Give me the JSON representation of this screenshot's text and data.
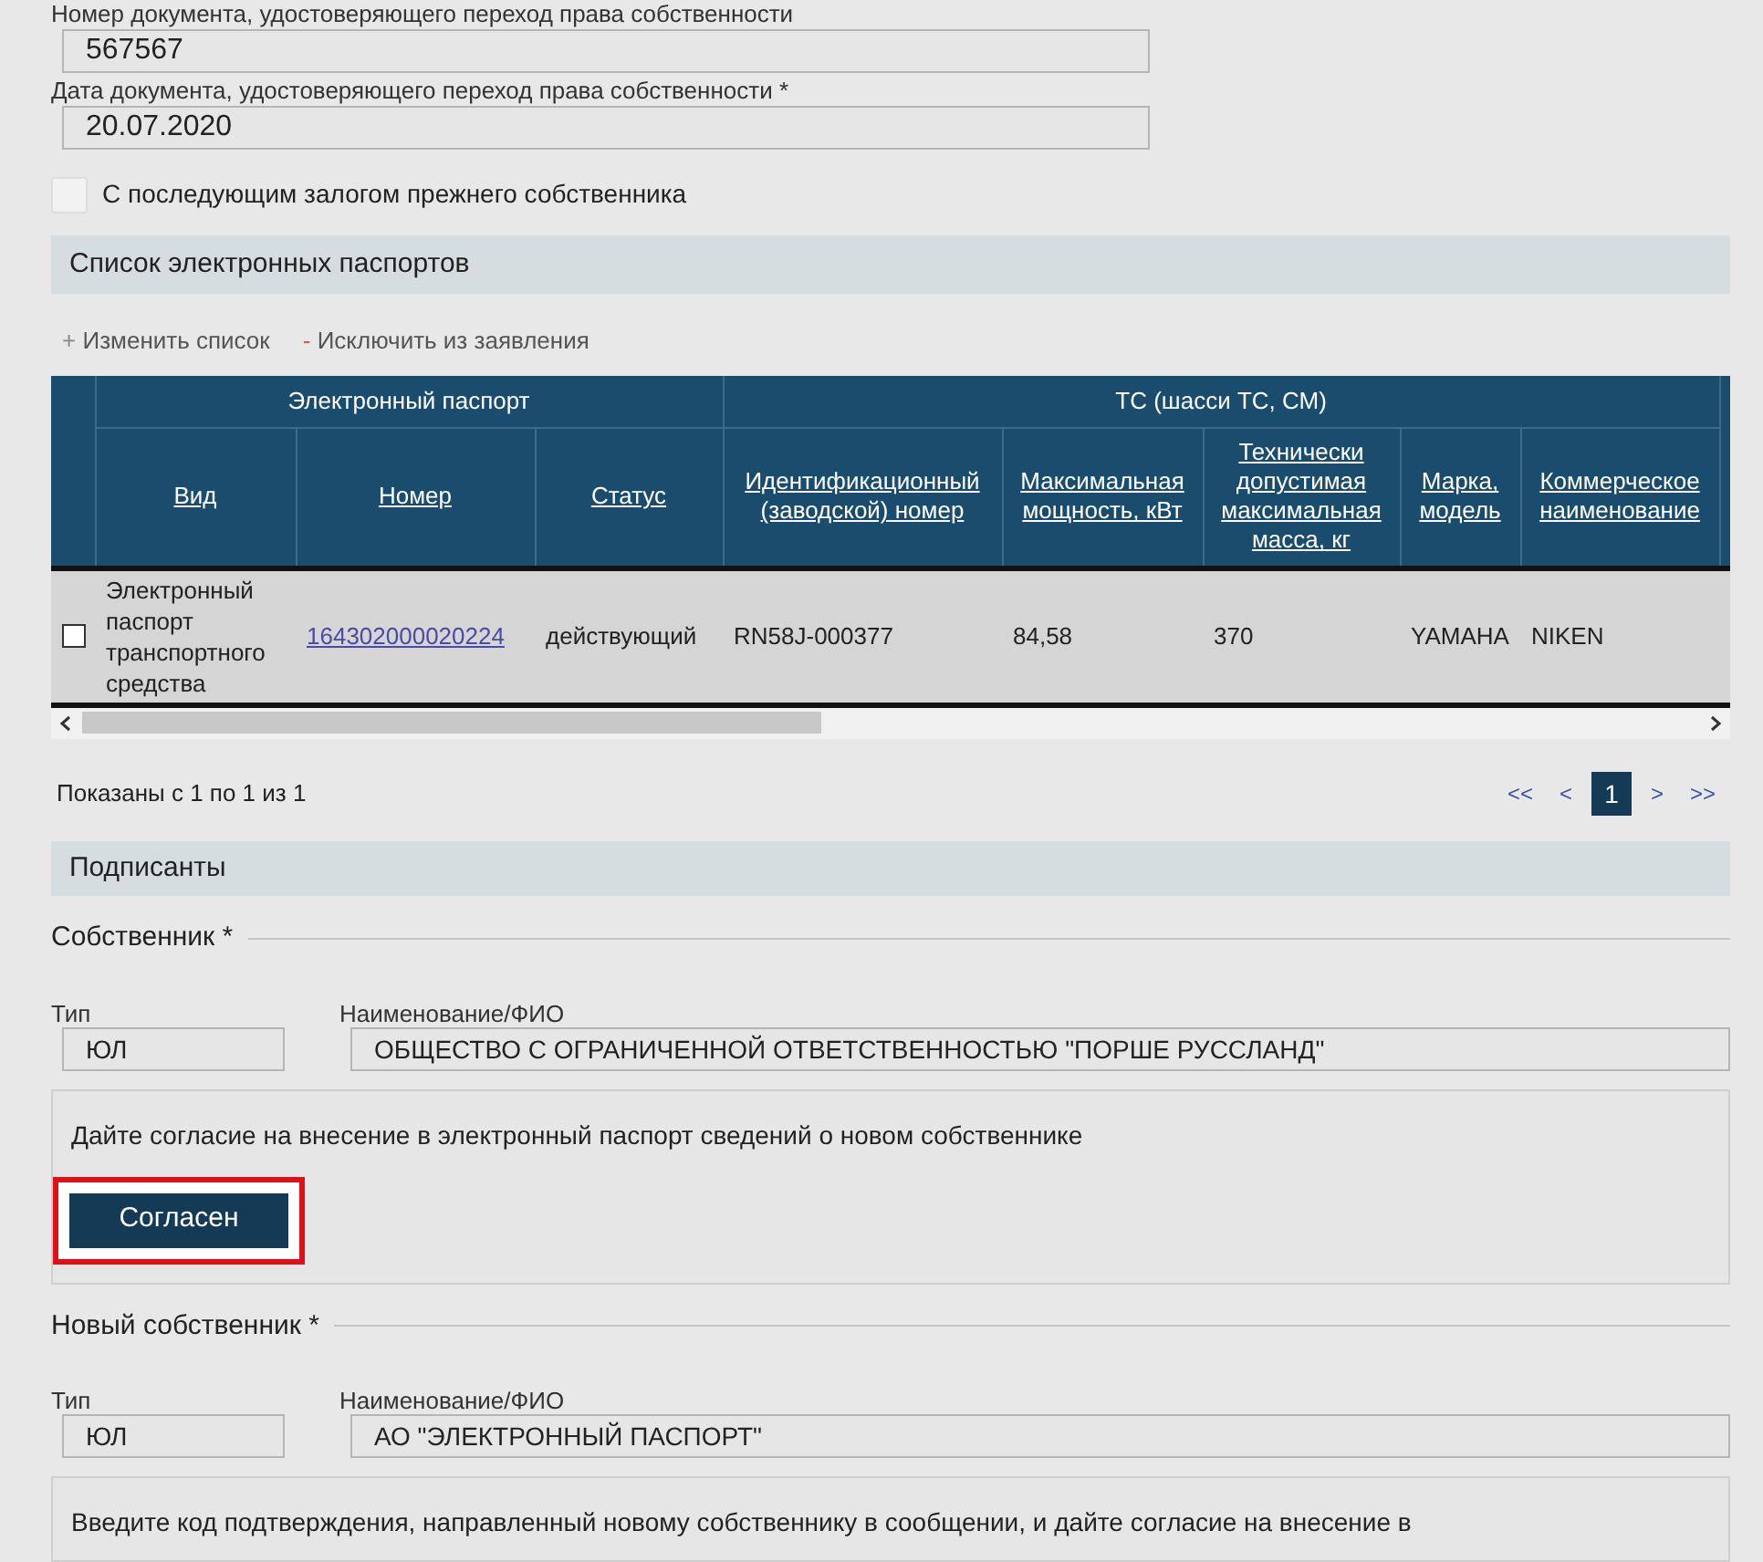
{
  "fields": [
    {
      "label": "Номер документа, удостоверяющего переход права собственности",
      "value": "567567"
    },
    {
      "label": "Дата документа, удостоверяющего переход права собственности *",
      "value": "20.07.2020"
    }
  ],
  "pledge_checkbox": {
    "label": "С последующим залогом прежнего собственника",
    "checked": false
  },
  "passports": {
    "title": "Список электронных паспортов",
    "actions": [
      {
        "kind": "add",
        "sign": "+",
        "label": "Изменить список"
      },
      {
        "kind": "remove",
        "sign": "-",
        "label": "Исключить из заявления"
      }
    ],
    "table": {
      "groups": [
        {
          "label": "Электронный паспорт",
          "columns": [
            "Вид",
            "Номер",
            "Статус"
          ]
        },
        {
          "label": "ТС (шасси ТС, СМ)",
          "columns": [
            "Идентификационный (заводской) номер",
            "Максимальная мощность, кВт",
            "Технически допустимая максимальная масса, кг",
            "Марка, модель",
            "Коммерческое наименование"
          ]
        }
      ],
      "rows": [
        {
          "checked": false,
          "type": "Электронный паспорт транспортного средства",
          "number": "164302000020224",
          "status": "действующий",
          "vin": "RN58J-000377",
          "power": "84,58",
          "mass": "370",
          "brand": "YAMAHA",
          "name": "NIKEN"
        }
      ]
    },
    "pagination": {
      "summary": "Показаны с 1 по 1 из 1",
      "buttons": [
        {
          "label": "<<",
          "selected": false
        },
        {
          "label": "<",
          "selected": false
        },
        {
          "label": "1",
          "selected": true
        },
        {
          "label": ">",
          "selected": false
        },
        {
          "label": ">>",
          "selected": false
        }
      ]
    }
  },
  "signers": {
    "title": "Подписанты",
    "parties": [
      {
        "title": "Собственник *",
        "type_label": "Тип",
        "type": "ЮЛ",
        "name_label": "Наименование/ФИО",
        "name": "ОБЩЕСТВО С ОГРАНИЧЕННОЙ ОТВЕТСТВЕННОСТЬЮ \"ПОРШЕ РУССЛАНД\"",
        "consent_text": "Дайте согласие на внесение в электронный паспорт сведений о новом собственнике",
        "button": "Согласен",
        "highlighted": true
      },
      {
        "title": "Новый собственник *",
        "type_label": "Тип",
        "type": "ЮЛ",
        "name_label": "Наименование/ФИО",
        "name": "АО \"ЭЛЕКТРОННЫЙ ПАСПОРТ\"",
        "consent_text": "Введите код подтверждения, направленный новому собственнику в сообщении, и дайте согласие на внесение в"
      }
    ]
  }
}
